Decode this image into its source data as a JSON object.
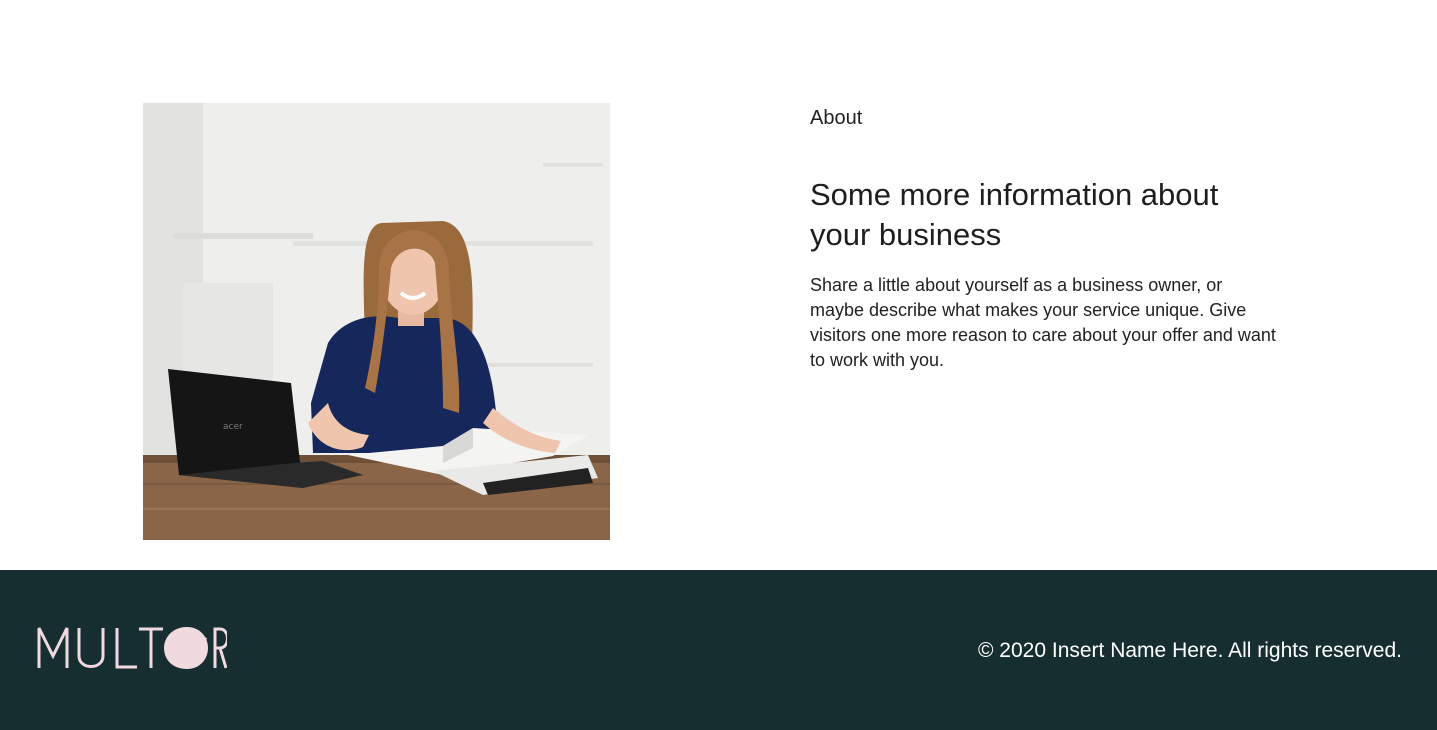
{
  "about": {
    "eyebrow": "About",
    "headline": "Some more information about your business",
    "body": "Share a little about yourself as a business owner, or maybe describe what makes your service unique. Give visitors one more reason to care about your offer and want to work with you.",
    "photo_icon": "business-owner-photo",
    "laptop_brand": "acer"
  },
  "footer": {
    "logo_text": "MULTOR",
    "copyright": "© 2020 Insert Name Here. All rights reserved.",
    "background_color": "#172e30",
    "logo_color": "#f0d9df"
  }
}
